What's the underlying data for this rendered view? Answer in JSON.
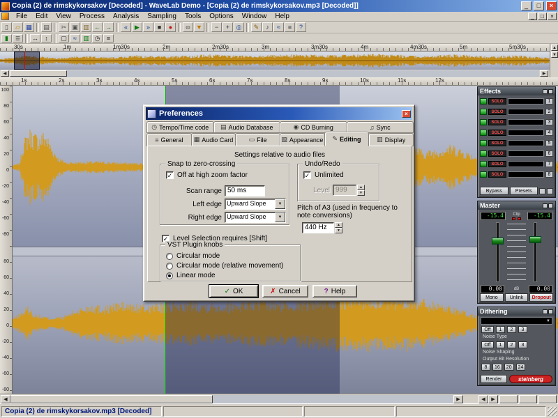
{
  "window": {
    "title": "Copia (2) de rimskykorsakov [Decoded] - WaveLab Demo - [Copia (2) de rimskykorsakov.mp3 [Decoded]]",
    "menu_items": [
      "File",
      "Edit",
      "View",
      "Process",
      "Analysis",
      "Sampling",
      "Tools",
      "Options",
      "Window",
      "Help"
    ]
  },
  "glyphs": {
    "check": "✓",
    "cross": "✗",
    "up": "▲",
    "down": "▼",
    "left": "◀",
    "right": "▶",
    "minimize": "_",
    "maximize": "□",
    "close": "×",
    "help": "?"
  },
  "toolbar_row1": [
    {
      "n": "new-file",
      "g": "▯",
      "c": "#505050"
    },
    {
      "n": "open-file",
      "g": "▱",
      "c": "#b8860b"
    },
    {
      "n": "save-file",
      "g": "▦",
      "c": "#1f3f9f"
    },
    {
      "n": "sep"
    },
    {
      "n": "print",
      "g": "▤",
      "c": "#505050"
    },
    {
      "n": "sep"
    },
    {
      "n": "cut",
      "g": "✂",
      "c": "#505050"
    },
    {
      "n": "copy",
      "g": "▣",
      "c": "#505050"
    },
    {
      "n": "paste",
      "g": "▥",
      "c": "#8a6d3b"
    },
    {
      "n": "undo",
      "g": "←",
      "c": "#1f6f1f"
    },
    {
      "n": "redo",
      "g": "→",
      "c": "#1f6f1f"
    },
    {
      "n": "sep"
    },
    {
      "n": "rewind",
      "g": "«",
      "c": "#103f8f"
    },
    {
      "n": "play",
      "g": "▶",
      "c": "#0a7a0a"
    },
    {
      "n": "fast-forward",
      "g": "»",
      "c": "#103f8f"
    },
    {
      "n": "stop",
      "g": "■",
      "c": "#303030"
    },
    {
      "n": "record",
      "g": "●",
      "c": "#c01010"
    },
    {
      "n": "sep"
    },
    {
      "n": "loop",
      "g": "∞",
      "c": "#303030"
    },
    {
      "n": "marker",
      "g": "▼",
      "c": "#c07800"
    },
    {
      "n": "sep"
    },
    {
      "n": "zoom-out",
      "g": "−",
      "c": "#303030"
    },
    {
      "n": "zoom-in",
      "g": "+",
      "c": "#303030"
    },
    {
      "n": "magnifier",
      "g": "◎",
      "c": "#103f8f"
    },
    {
      "n": "sep"
    },
    {
      "n": "pencil",
      "g": "✎",
      "c": "#8a6000"
    },
    {
      "n": "speaker",
      "g": "♪",
      "c": "#303030"
    },
    {
      "n": "analyze",
      "g": "≈",
      "c": "#103f8f"
    },
    {
      "n": "settings",
      "g": "≡",
      "c": "#303030"
    },
    {
      "n": "help",
      "g": "?",
      "c": "#103f8f"
    }
  ],
  "toolbar_row2": [
    {
      "n": "level-meter",
      "g": "▮",
      "c": "#0a7a0a"
    },
    {
      "n": "spectrum",
      "g": "≣",
      "c": "#505050"
    },
    {
      "n": "sep"
    },
    {
      "n": "zoom-horizontal",
      "g": "↔",
      "c": "#303030"
    },
    {
      "n": "zoom-vertical",
      "g": "↕",
      "c": "#303030"
    },
    {
      "n": "sep"
    },
    {
      "n": "selection-tool",
      "g": "▢",
      "c": "#303030"
    },
    {
      "n": "snap-toggle",
      "g": "≈",
      "c": "#103f8f"
    },
    {
      "n": "vu-meter",
      "g": "▥",
      "c": "#0a7a0a"
    },
    {
      "n": "timecode",
      "g": "◷",
      "c": "#303030"
    },
    {
      "n": "config",
      "g": "≡",
      "c": "#303030"
    }
  ],
  "rulers": {
    "overview_labels": [
      "30s",
      "1m",
      "1m30s",
      "2m",
      "2m30s",
      "3m",
      "3m30s",
      "4m",
      "4m30s",
      "5m",
      "5m30s"
    ],
    "main_labels": [
      "1s",
      "2s",
      "3s",
      "4s",
      "5s",
      "6s",
      "7s",
      "8s",
      "9s",
      "10s",
      "11s",
      "12s"
    ],
    "level_top": [
      "100",
      "80",
      "60",
      "40",
      "20",
      "0",
      "-20",
      "-40",
      "-60",
      "-80"
    ],
    "level_bottom": [
      "80",
      "60",
      "40",
      "20",
      "0",
      "-20",
      "-40",
      "-60",
      "-80"
    ]
  },
  "dialog": {
    "title": "Preferences",
    "tabs_row1": [
      {
        "label": "Tempo/Time code",
        "glyph": "◷"
      },
      {
        "label": "Audio Database",
        "glyph": "▤"
      },
      {
        "label": "CD Burning",
        "glyph": "◉"
      },
      {
        "label": "Sync",
        "glyph": "♫"
      }
    ],
    "tabs_row2": [
      {
        "label": "General",
        "glyph": "≡"
      },
      {
        "label": "Audio Card",
        "glyph": "▦"
      },
      {
        "label": "File",
        "glyph": "▭"
      },
      {
        "label": "Appearance",
        "glyph": "▧"
      },
      {
        "label": "Editing",
        "glyph": "✎",
        "active": true
      },
      {
        "label": "Display",
        "glyph": "▥"
      }
    ],
    "heading": "Settings relative to audio files",
    "snap": {
      "title": "Snap to zero-crossing",
      "zoom_checkbox": "Off at high zoom factor",
      "scan_label": "Scan range",
      "scan_value": "50 ms",
      "left_label": "Left edge",
      "left_value": "Upward Slope",
      "right_label": "Right edge",
      "right_value": "Upward Slope"
    },
    "undo": {
      "title": "Undo/Redo",
      "unlimited": "Unlimited",
      "level_label": "Level",
      "level_value": "999"
    },
    "pitch_label": "Pitch of A3 (used in frequency to note conversions)",
    "pitch_value": "440 Hz",
    "shift_checkbox": "Level Selection requires [Shift]",
    "vst": {
      "title": "VST Plugin knobs",
      "options": [
        "Circular mode",
        "Circular mode (relative movement)",
        "Linear mode"
      ],
      "selected_index": 2
    },
    "ok": "OK",
    "cancel": "Cancel",
    "help": "Help"
  },
  "effects": {
    "title": "Effects",
    "solo": "SOLO",
    "slots": [
      "1",
      "2",
      "3",
      "4",
      "5",
      "6",
      "7",
      "8"
    ],
    "bypass": "Bypass",
    "presets": "Presets"
  },
  "master": {
    "title": "Master",
    "peak_left": "-15.4",
    "peak_right": "-15.4",
    "clip": "Clip",
    "gain_left": "0.00",
    "gain_right": "0.00",
    "db": "dB",
    "buttons": [
      "Mono",
      "Unlink",
      "Dropout"
    ]
  },
  "dithering": {
    "title": "Dithering",
    "off": "Off",
    "numbers": [
      "1",
      "2",
      "3"
    ],
    "noise_type": "Noise Type",
    "noise_shaping": "Noise Shaping",
    "output": "Output Bit Resolution",
    "bits": [
      "8",
      "16",
      "20",
      "24"
    ],
    "render": "Render",
    "brand": "steinberg"
  },
  "statusbar": {
    "filename": "Copia (2) de rimskykorsakov.mp3 [Decoded]"
  }
}
